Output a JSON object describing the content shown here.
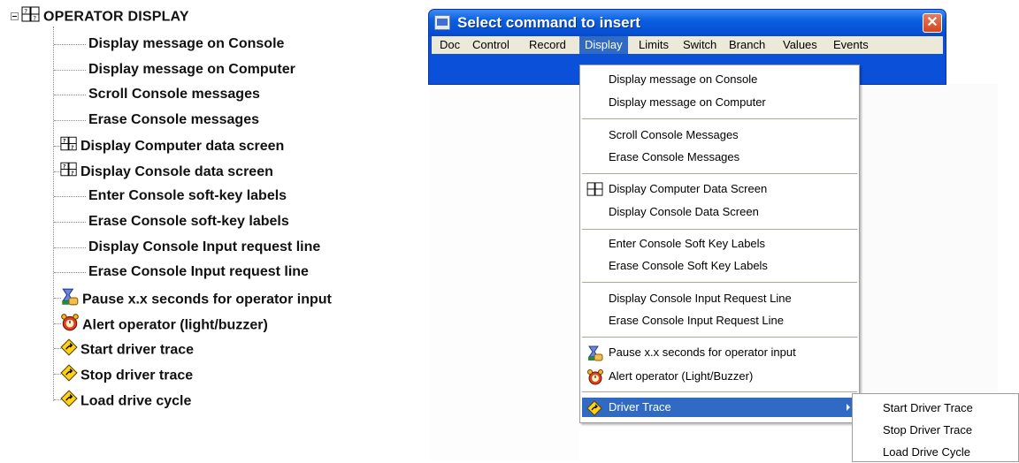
{
  "tree": {
    "root_label": "OPERATOR DISPLAY",
    "items": [
      {
        "label": "Display message on Console",
        "icon": ""
      },
      {
        "label": "Display message on Computer",
        "icon": ""
      },
      {
        "label": "Scroll Console messages",
        "icon": ""
      },
      {
        "label": "Erase Console messages",
        "icon": ""
      },
      {
        "label": "Display Computer data screen",
        "icon": "data-screen-icon"
      },
      {
        "label": "Display Console data screen",
        "icon": "data-screen-icon"
      },
      {
        "label": "Enter Console soft-key labels",
        "icon": ""
      },
      {
        "label": "Erase Console soft-key labels",
        "icon": ""
      },
      {
        "label": "Display Console Input request line",
        "icon": ""
      },
      {
        "label": "Erase Console Input request line",
        "icon": ""
      },
      {
        "label": "Pause x.x seconds for operator input",
        "icon": "hourglass-hand-icon"
      },
      {
        "label": "Alert operator (light/buzzer)",
        "icon": "alarm-clock-icon"
      },
      {
        "label": "Start driver trace",
        "icon": "driver-trace-icon"
      },
      {
        "label": "Stop driver trace",
        "icon": "driver-trace-icon"
      },
      {
        "label": "Load drive cycle",
        "icon": "driver-trace-icon"
      }
    ]
  },
  "dialog": {
    "title": "Select command to insert",
    "close_label": "✕",
    "menu": [
      "Doc",
      "Control",
      "Record",
      "Display",
      "Limits",
      "Switch",
      "Branch",
      "Values",
      "Events"
    ],
    "active_menu": "Display"
  },
  "dropdown": {
    "items": [
      "Display message on Console",
      "Display message on Computer",
      "Scroll Console Messages",
      "Erase Console Messages",
      "Display Computer Data Screen",
      "Display Console Data Screen",
      "Enter Console Soft Key Labels",
      "Erase Console Soft Key Labels",
      "Display Console Input Request Line",
      "Erase Console Input Request Line",
      "Pause x.x seconds for operator input",
      "Alert operator (Light/Buzzer)",
      "Driver Trace"
    ]
  },
  "submenu": {
    "items": [
      "Start Driver Trace",
      "Stop Driver Trace",
      "Load Drive Cycle"
    ]
  },
  "colors": {
    "titlebar": "#0a5fe0",
    "highlight": "#316ac5",
    "menubar": "#ece9d8",
    "close": "#d2461f"
  }
}
